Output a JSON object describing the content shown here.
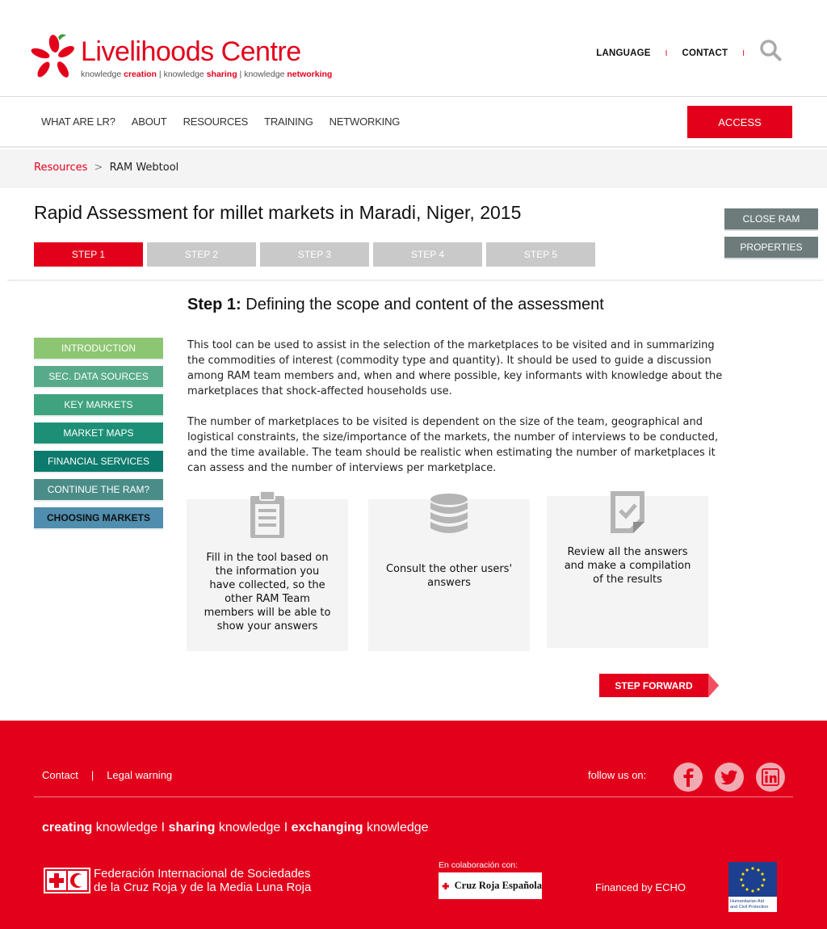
{
  "header": {
    "logo": {
      "name_part1": "Live",
      "name_part2": "lihoods Centre",
      "tagline": {
        "w1": "knowledge",
        "b1": "creation",
        "sep1": "|",
        "w2": "knowledge",
        "b2": "sharing",
        "sep2": "|",
        "w3": "knowledge",
        "b3": "networking"
      }
    },
    "top_links": [
      "LANGUAGE",
      "CONTACT"
    ],
    "separator": "I",
    "search_icon": "search-icon"
  },
  "nav": {
    "items": [
      "WHAT ARE LR?",
      "ABOUT",
      "RESOURCES",
      "TRAINING",
      "NETWORKING"
    ],
    "access_label": "ACCESS"
  },
  "breadcrumb": {
    "link": "Resources",
    "separator": ">",
    "current": "RAM Webtool"
  },
  "page": {
    "title": "Rapid Assessment for millet markets in Maradi, Niger, 2015",
    "steps": [
      "STEP 1",
      "STEP 2",
      "STEP 3",
      "STEP 4",
      "STEP 5"
    ],
    "active_step": 0,
    "close_ram_label": "CLOSE RAM",
    "properties_label": "PROPERTIES"
  },
  "sub_menu": {
    "items": [
      {
        "label": "INTRODUCTION",
        "color": "#8dc673"
      },
      {
        "label": "SEC. DATA SOURCES",
        "color": "#58ab8a"
      },
      {
        "label": "KEY MARKETS",
        "color": "#3fa37f"
      },
      {
        "label": "MARKET MAPS",
        "color": "#1e8f77"
      },
      {
        "label": "FINANCIAL SERVICES",
        "color": "#0c7a6c"
      },
      {
        "label": "CONTINUE THE RAM?",
        "color": "#4a8c88"
      },
      {
        "label": "CHOOSING MARKETS",
        "color": "#4f8eae"
      }
    ],
    "active_index": 6
  },
  "content": {
    "heading_bold": "Step 1:",
    "heading_text": "Defining the scope and content of the assessment",
    "paragraph1": "This tool can be used to assist in the selection of the marketplaces to be visited and in summarizing the commodities of interest (commodity type and quantity). It should be used to guide a discussion among RAM team members and, when and where possible, key informants with knowledge about the marketplaces that shock-affected households use.",
    "paragraph2": "The number of marketplaces to be visited is dependent on the size of the team, geographical and logistical constraints, the size/importance of the markets, the number of interviews to be conducted, and the time available. The team should be realistic when estimating the number of marketplaces it can assess and the number of interviews per marketplace.",
    "cards": [
      {
        "icon": "clipboard-icon",
        "text": "Fill in the tool based on the information you have collected, so the other RAM Team members will be able to show your answers"
      },
      {
        "icon": "database-icon",
        "text": "Consult the other users' answers"
      },
      {
        "icon": "document-check-icon",
        "text": "Review all the answers and make a compilation of the results"
      }
    ],
    "step_forward_label": "STEP FORWARD"
  },
  "footer": {
    "links": [
      "Contact",
      "Legal warning"
    ],
    "link_separator": "|",
    "follow_label": "follow us on:",
    "social": [
      "facebook-icon",
      "twitter-icon",
      "linkedin-icon"
    ],
    "tagline": {
      "b1": "creating",
      "w1": "knowledge",
      "sep1": "I",
      "b2": "sharing",
      "w2": "knowledge",
      "sep2": "I",
      "b3": "exchanging",
      "w3": "knowledge"
    },
    "ifrc_line1": "Federación Internacional de Sociedades",
    "ifrc_line2": "de la Cruz Roja y de la Media Luna Roja",
    "collab_label": "En colaboración con:",
    "cruz_roja_label": "Cruz Roja Española",
    "financed_label": "Financed by ECHO",
    "echo_caption_line1": "Humanitarian Aid",
    "echo_caption_line2": "and Civil Protection"
  },
  "colors": {
    "brand_red": "#e3001b",
    "inactive_step": "#c9c9c9",
    "side_button": "#6d7b7b",
    "card_bg": "#f4f4f4",
    "icon_grey": "#b5b5b5"
  }
}
